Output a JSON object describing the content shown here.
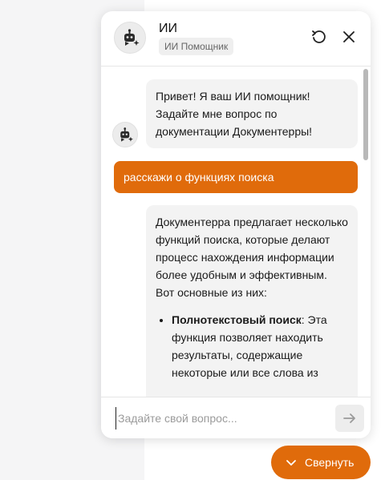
{
  "header": {
    "assistant_name": "ИИ",
    "assistant_badge": "ИИ Помощник"
  },
  "messages": {
    "bot_greeting": "Привет! Я ваш ИИ помощник! Задайте мне вопрос по документации Документерры!",
    "user_question": "расскажи о функциях поиска",
    "bot_answer_intro": "Документерра предлагает несколько функций поиска, которые делают процесс нахождения информации более удобным и эффективным. Вот основные из них:",
    "bot_answer_item1_title": "Полнотекстовый поиск",
    "bot_answer_item1_text": ": Эта функция позволяет находить результаты, содержащие некоторые или все слова из"
  },
  "input": {
    "placeholder": "Задайте свой вопрос..."
  },
  "footer": {
    "collapse_label": "Свернуть"
  },
  "colors": {
    "accent": "#e06b0b"
  },
  "icons": {
    "bot": "robot-sparkle-icon",
    "reset": "reset-icon",
    "close": "close-icon",
    "send": "arrow-right-icon",
    "collapse": "chevron-down-icon"
  }
}
